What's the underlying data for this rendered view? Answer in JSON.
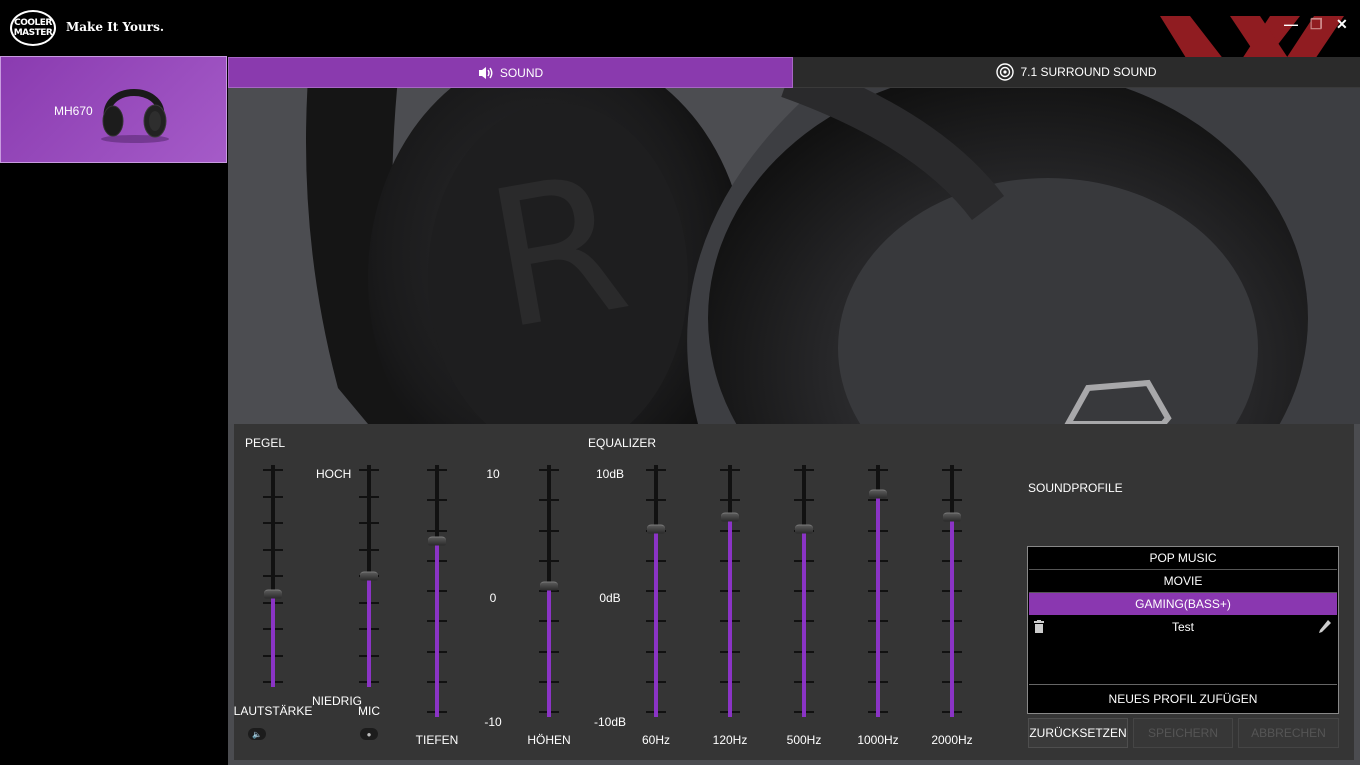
{
  "app": {
    "logo_line1": "COOLER",
    "logo_line2": "MASTER",
    "tagline": "Make It Yours.",
    "window_controls": {
      "minimize": "—",
      "maximize": "❐",
      "close": "✕"
    }
  },
  "sidebar": {
    "device": {
      "name": "MH670"
    }
  },
  "tabs": [
    {
      "label": "SOUND",
      "active": true
    },
    {
      "label": "7.1 SURROUND SOUND",
      "active": false
    }
  ],
  "controls": {
    "pegel_title": "PEGEL",
    "equalizer_title": "EQUALIZER",
    "hoch": "HOCH",
    "niedrig": "NIEDRIG",
    "scale_10": "10",
    "scale_0": "0",
    "scale_m10": "-10",
    "db_high": "10dB",
    "db_mid": "0dB",
    "db_low": "-10dB",
    "sliders": [
      {
        "id": "lautstaerke",
        "label": "LAUTSTÄRKE",
        "level": 0.42
      },
      {
        "id": "mic",
        "label": "MIC",
        "level": 0.5
      },
      {
        "id": "tiefen",
        "label": "TIEFEN",
        "level": 0.7
      },
      {
        "id": "hoehen",
        "label": "HÖHEN",
        "level": 0.52
      },
      {
        "id": "eq60",
        "label": "60Hz",
        "level": 0.745
      },
      {
        "id": "eq120",
        "label": "120Hz",
        "level": 0.795
      },
      {
        "id": "eq500",
        "label": "500Hz",
        "level": 0.745
      },
      {
        "id": "eq1000",
        "label": "1000Hz",
        "level": 0.885
      },
      {
        "id": "eq2000",
        "label": "2000Hz",
        "level": 0.795
      }
    ]
  },
  "soundprofile": {
    "title": "SOUNDPROFILE",
    "items": [
      {
        "label": "POP MUSIC"
      },
      {
        "label": "MOVIE"
      },
      {
        "label": "GAMING(BASS+)",
        "selected": true
      },
      {
        "label": "Test"
      }
    ],
    "add_label": "NEUES PROFIL ZUFÜGEN",
    "reset_label": "ZURÜCKSETZEN",
    "save_label": "SPEICHERN",
    "cancel_label": "ABBRECHEN"
  },
  "colors": {
    "accent": "#8a37b0",
    "panel": "#353535",
    "background": "#000000"
  }
}
